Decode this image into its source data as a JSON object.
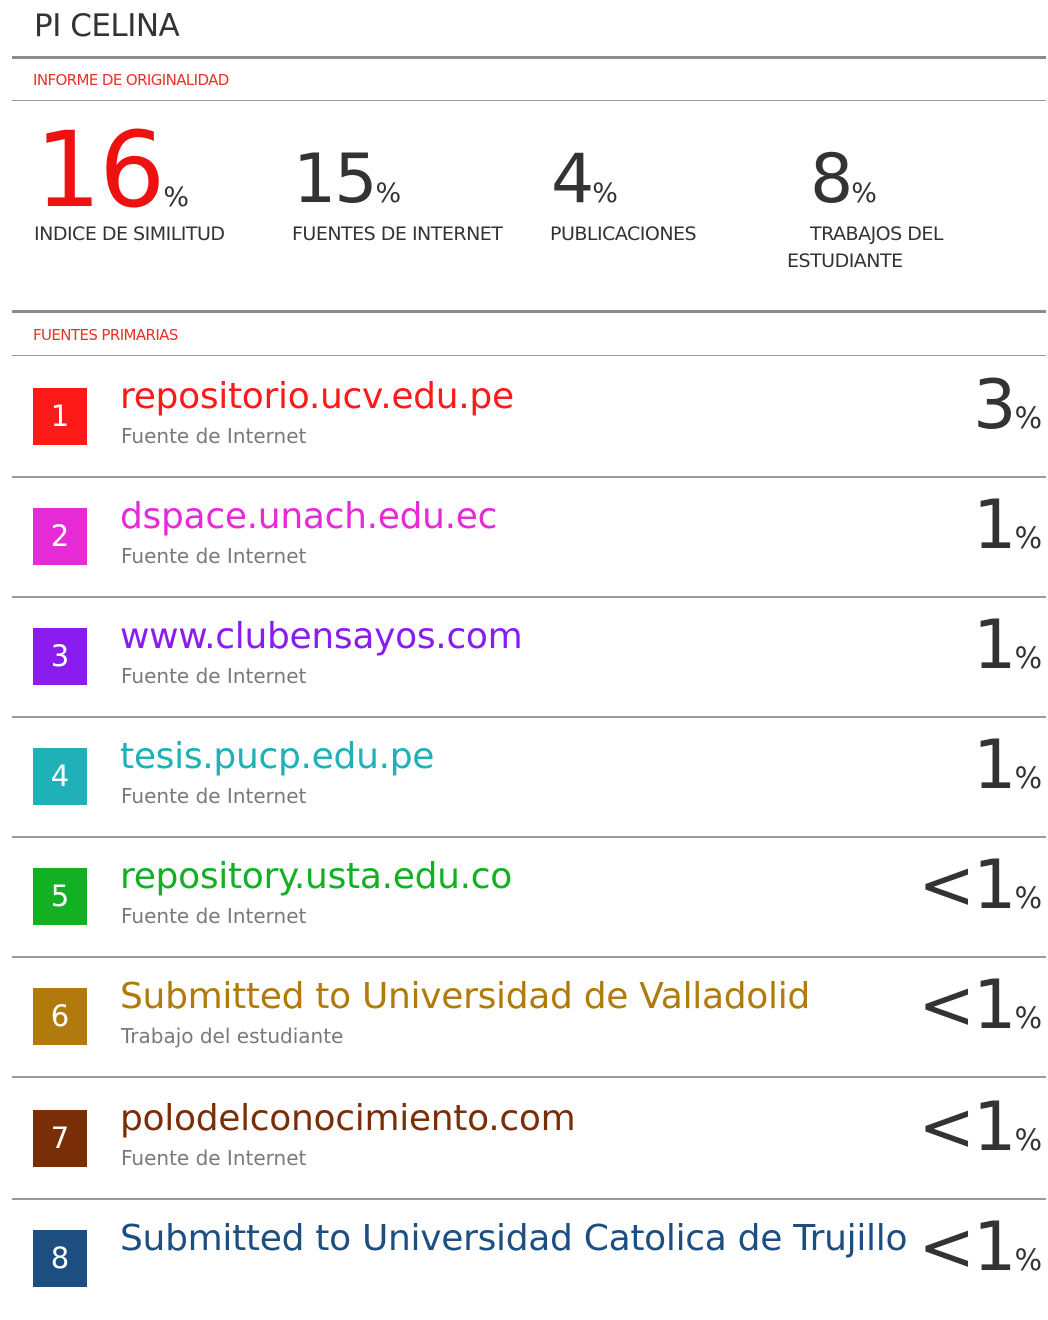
{
  "document": {
    "title": "PI CELINA"
  },
  "report": {
    "header_label": "INFORME DE ORIGINALIDAD",
    "stats": [
      {
        "value": "16",
        "unit": "%",
        "label": "INDICE DE SIMILITUD",
        "color": "#ee1111"
      },
      {
        "value": "15",
        "unit": "%",
        "label": "FUENTES DE INTERNET",
        "color": "#333333"
      },
      {
        "value": "4",
        "unit": "%",
        "label": "PUBLICACIONES",
        "color": "#333333"
      },
      {
        "value": "8",
        "unit": "%",
        "label_line1": "TRABAJOS DEL",
        "label_line2": "ESTUDIANTE",
        "color": "#333333"
      }
    ]
  },
  "sources": {
    "header_label": "FUENTES PRIMARIAS",
    "items": [
      {
        "rank": "1",
        "name": "repositorio.ucv.edu.pe",
        "type": "Fuente de Internet",
        "value": "3",
        "unit": "%",
        "color": "#ff1a1a"
      },
      {
        "rank": "2",
        "name": "dspace.unach.edu.ec",
        "type": "Fuente de Internet",
        "value": "1",
        "unit": "%",
        "color": "#e62bd6"
      },
      {
        "rank": "3",
        "name": "www.clubensayos.com",
        "type": "Fuente de Internet",
        "value": "1",
        "unit": "%",
        "color": "#8a1cf0"
      },
      {
        "rank": "4",
        "name": "tesis.pucp.edu.pe",
        "type": "Fuente de Internet",
        "value": "1",
        "unit": "%",
        "color": "#1fb0b8"
      },
      {
        "rank": "5",
        "name": "repository.usta.edu.co",
        "type": "Fuente de Internet",
        "value": "<1",
        "unit": "%",
        "color": "#13b024"
      },
      {
        "rank": "6",
        "name": "Submitted to Universidad de Valladolid",
        "type": "Trabajo del estudiante",
        "value": "<1",
        "unit": "%",
        "color": "#b07a0c"
      },
      {
        "rank": "7",
        "name": "polodelconocimiento.com",
        "type": "Fuente de Internet",
        "value": "<1",
        "unit": "%",
        "color": "#7a2e08"
      },
      {
        "rank": "8",
        "name": "Submitted to Universidad Catolica de Trujillo",
        "type": "",
        "value": "<1",
        "unit": "%",
        "color": "#1d4e82"
      }
    ]
  }
}
